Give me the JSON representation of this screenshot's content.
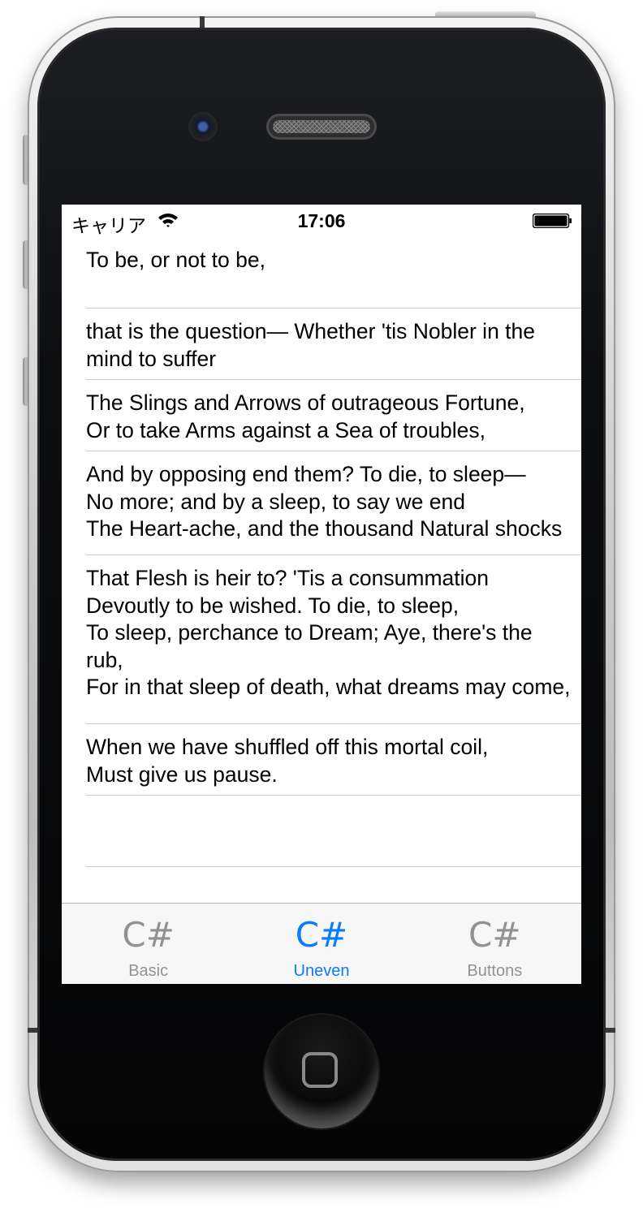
{
  "status_bar": {
    "carrier": "キャリア",
    "time": "17:06",
    "wifi_icon": "wifi-icon",
    "battery_icon": "battery-icon"
  },
  "rows": [
    {
      "text": "To be, or not to be,"
    },
    {
      "text": "that is the question— Whether 'tis Nobler in the mind to suffer"
    },
    {
      "text": "The Slings and Arrows of outrageous Fortune,\nOr to take Arms against a Sea of troubles,"
    },
    {
      "text": "And by opposing end them? To die, to sleep—\nNo more; and by a sleep, to say we end\nThe Heart-ache, and the thousand Natural shocks"
    },
    {
      "text": "That Flesh is heir to? 'Tis a consummation\nDevoutly to be wished. To die, to sleep,\nTo sleep, perchance to Dream; Aye, there's the rub,\nFor in that sleep of death, what dreams may come,"
    },
    {
      "text": "When we have shuffled off this mortal coil,\nMust give us pause."
    },
    {
      "text": ""
    }
  ],
  "tabs": [
    {
      "icon": "C#",
      "label": "Basic",
      "active": false
    },
    {
      "icon": "C#",
      "label": "Uneven",
      "active": true
    },
    {
      "icon": "C#",
      "label": "Buttons",
      "active": false
    }
  ],
  "colors": {
    "tab_active": "#0a7aff",
    "tab_inactive": "#929292",
    "separator": "#c8c7cc",
    "tab_bar_bg": "#f7f7f7"
  }
}
